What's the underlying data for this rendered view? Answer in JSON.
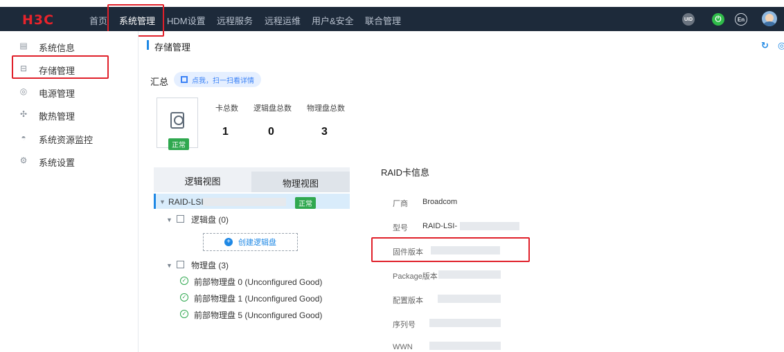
{
  "navbar": {
    "logo": "H3C",
    "items": [
      "首页",
      "系统管理",
      "HDM设置",
      "远程服务",
      "远程运维",
      "用户&安全",
      "联合管理"
    ],
    "active_index": 1,
    "uid_label": "UID",
    "lang_label": "En"
  },
  "sidebar": {
    "items": [
      {
        "label": "系统信息",
        "icon": "document-icon"
      },
      {
        "label": "存储管理",
        "icon": "storage-icon"
      },
      {
        "label": "电源管理",
        "icon": "power-plug-icon"
      },
      {
        "label": "散热管理",
        "icon": "fan-icon"
      },
      {
        "label": "系统资源监控",
        "icon": "gauge-icon"
      },
      {
        "label": "系统设置",
        "icon": "gear-icon"
      }
    ],
    "active_index": 1
  },
  "page": {
    "title": "存储管理"
  },
  "summary": {
    "label": "汇总",
    "scan_hint": "点我，扫一扫看详情",
    "status": "正常",
    "stats": [
      {
        "label": "卡总数",
        "value": "1"
      },
      {
        "label": "逻辑盘总数",
        "value": "0"
      },
      {
        "label": "物理盘总数",
        "value": "3"
      }
    ]
  },
  "tabs": {
    "logical": "逻辑视图",
    "physical": "物理视图"
  },
  "tree": {
    "raid_name": "RAID-LSI-",
    "raid_status": "正常",
    "logical_group": "逻辑盘 (0)",
    "create_button": "创建逻辑盘",
    "physical_group": "物理盘 (3)",
    "disks": [
      "前部物理盘 0 (Unconfigured Good)",
      "前部物理盘 1 (Unconfigured Good)",
      "前部物理盘 5 (Unconfigured Good)"
    ]
  },
  "raid_info": {
    "title": "RAID卡信息",
    "rows": [
      {
        "label": "厂商",
        "value": "Broadcom"
      },
      {
        "label": "型号",
        "value": "RAID-LSI-"
      },
      {
        "label": "固件版本",
        "value": ""
      },
      {
        "label": "Package版本",
        "value": ""
      },
      {
        "label": "配置版本",
        "value": ""
      },
      {
        "label": "序列号",
        "value": ""
      },
      {
        "label": "WWN",
        "value": ""
      }
    ]
  }
}
